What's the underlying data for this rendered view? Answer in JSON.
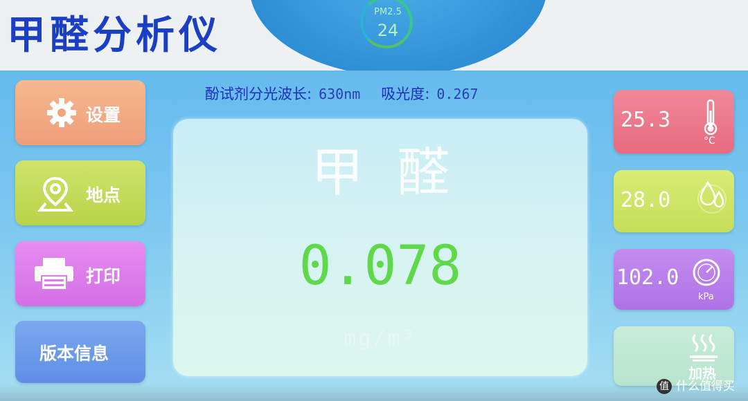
{
  "header": {
    "title": "甲醛分析仪",
    "pm_label": "PM2.5",
    "pm_value": "24"
  },
  "readout": {
    "wavelength_label": "酚试剂分光波长:",
    "wavelength_value": "630nm",
    "absorbance_label": "吸光度:",
    "absorbance_value": "0.267"
  },
  "menu": [
    {
      "label": "设置",
      "icon": "gear-icon",
      "color": "#f0a57e"
    },
    {
      "label": "地点",
      "icon": "location-pin-icon",
      "color": "#c4db52"
    },
    {
      "label": "打印",
      "icon": "printer-icon",
      "color": "#dc7cea"
    },
    {
      "label": "版本信息",
      "icon": "",
      "color": "#6b98ea"
    }
  ],
  "main": {
    "substance": "甲醛",
    "value": "0.078",
    "unit": "mg/m³"
  },
  "sensors": {
    "temperature_value": "25.3",
    "temperature_unit": "°C",
    "humidity_value": "28.0",
    "pressure_value": "102.0",
    "pressure_unit": "kPa",
    "heat_label": "加热"
  },
  "watermark": {
    "badge": "值",
    "text": "什么值得买"
  }
}
